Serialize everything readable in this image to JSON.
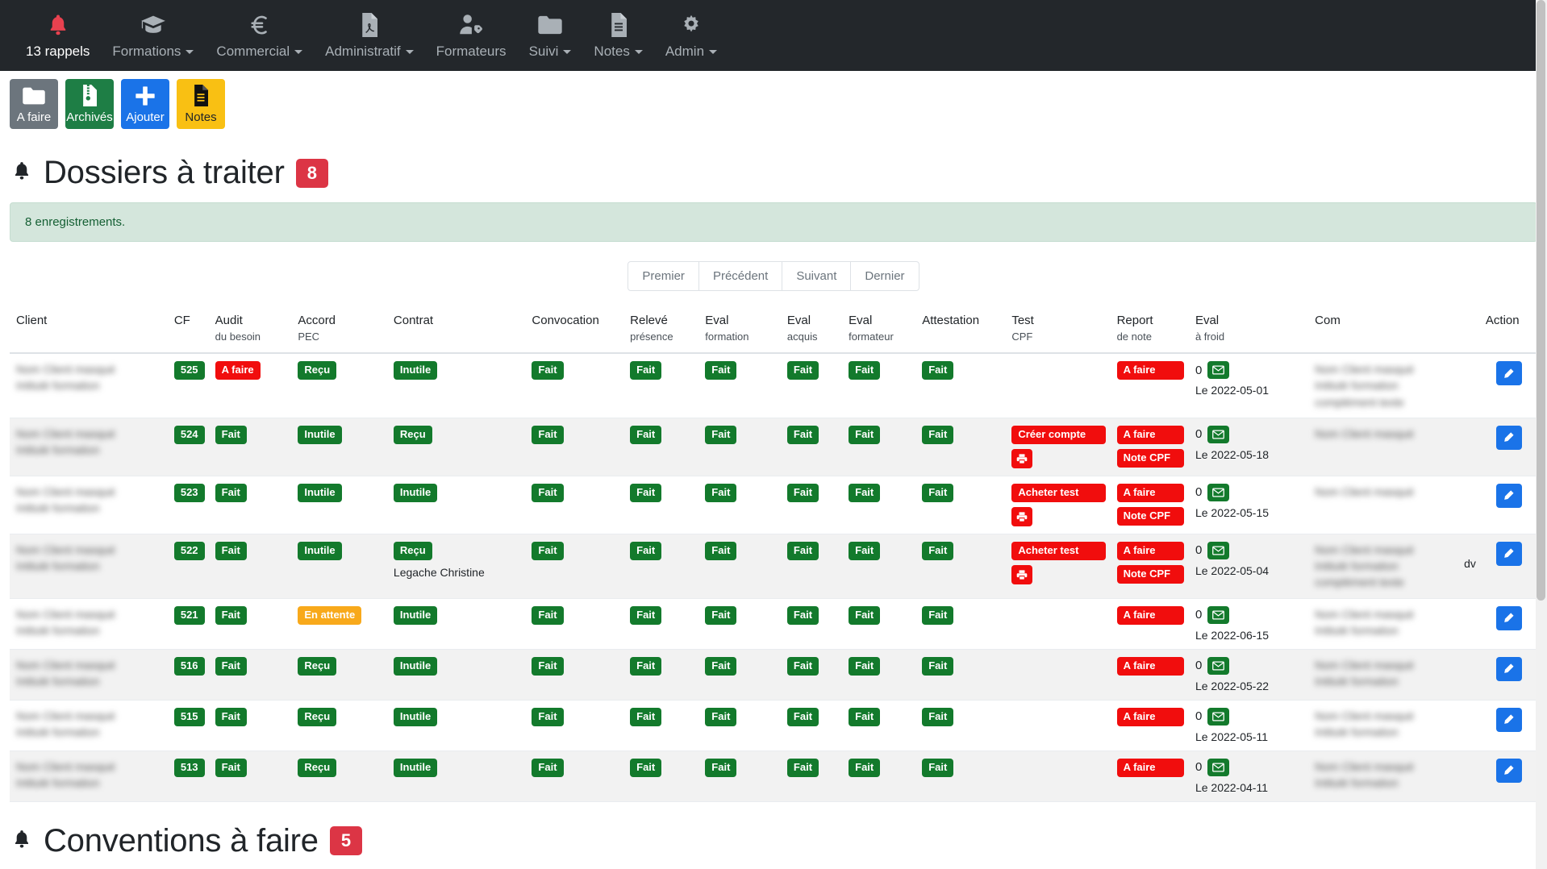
{
  "navbar": {
    "items": [
      {
        "label": "13 rappels",
        "icon": "bell-icon",
        "active": true,
        "caret": false
      },
      {
        "label": "Formations",
        "icon": "graduation-icon",
        "active": false,
        "caret": true
      },
      {
        "label": "Commercial",
        "icon": "euro-icon",
        "active": false,
        "caret": true
      },
      {
        "label": "Administratif",
        "icon": "pdf-file-icon",
        "active": false,
        "caret": true
      },
      {
        "label": "Formateurs",
        "icon": "user-tag-icon",
        "active": false,
        "caret": false
      },
      {
        "label": "Suivi",
        "icon": "folder-icon",
        "active": false,
        "caret": true
      },
      {
        "label": "Notes",
        "icon": "note-file-icon",
        "active": false,
        "caret": true
      },
      {
        "label": "Admin",
        "icon": "gear-icon",
        "active": false,
        "caret": true
      }
    ]
  },
  "toolbar": {
    "buttons": [
      {
        "label": "A faire",
        "icon": "folder-icon",
        "style": "grey"
      },
      {
        "label": "Archivés",
        "icon": "archive-icon",
        "style": "green"
      },
      {
        "label": "Ajouter",
        "icon": "plus-icon",
        "style": "blue"
      },
      {
        "label": "Notes",
        "icon": "note-icon",
        "style": "yellow"
      }
    ]
  },
  "page": {
    "title": "Dossiers à traiter",
    "title_badge": "8",
    "alert": "8 enregistrements."
  },
  "pagination": {
    "first": "Premier",
    "previous": "Précédent",
    "next": "Suivant",
    "last": "Dernier"
  },
  "table": {
    "headers": [
      {
        "main": "Client",
        "sub": ""
      },
      {
        "main": "CF",
        "sub": ""
      },
      {
        "main": "Audit",
        "sub": "du besoin"
      },
      {
        "main": "Accord",
        "sub": "PEC"
      },
      {
        "main": "Contrat",
        "sub": ""
      },
      {
        "main": "Convocation",
        "sub": ""
      },
      {
        "main": "Relevé",
        "sub": "présence"
      },
      {
        "main": "Eval",
        "sub": "formation"
      },
      {
        "main": "Eval",
        "sub": "acquis"
      },
      {
        "main": "Eval",
        "sub": "formateur"
      },
      {
        "main": "Attestation",
        "sub": ""
      },
      {
        "main": "Test",
        "sub": "CPF"
      },
      {
        "main": "Report",
        "sub": "de note"
      },
      {
        "main": "Eval",
        "sub": "à froid"
      },
      {
        "main": "Com",
        "sub": ""
      },
      {
        "main": "Action",
        "sub": ""
      }
    ],
    "rows": [
      {
        "client_redacted_lines": 2,
        "cf": "525",
        "audit": {
          "text": "A faire",
          "color": "red"
        },
        "accord": {
          "text": "Reçu",
          "color": "green"
        },
        "contrat": {
          "text": "Inutile",
          "color": "green"
        },
        "contrat_note": "",
        "convocation": {
          "text": "Fait",
          "color": "green"
        },
        "releve": {
          "text": "Fait",
          "color": "green"
        },
        "eval_formation": {
          "text": "Fait",
          "color": "green"
        },
        "eval_acquis": {
          "text": "Fait",
          "color": "green"
        },
        "eval_formateur": {
          "text": "Fait",
          "color": "green"
        },
        "attestation": {
          "text": "Fait",
          "color": "green"
        },
        "test_cpf": [],
        "test_cpf_print": false,
        "report": [
          {
            "text": "A faire",
            "color": "red"
          }
        ],
        "froid_count": "0",
        "froid_date": "Le 2022-05-01",
        "com_redacted_lines": 3,
        "com_visible": ""
      },
      {
        "client_redacted_lines": 2,
        "cf": "524",
        "audit": {
          "text": "Fait",
          "color": "green"
        },
        "accord": {
          "text": "Inutile",
          "color": "green"
        },
        "contrat": {
          "text": "Reçu",
          "color": "green"
        },
        "contrat_note": "",
        "convocation": {
          "text": "Fait",
          "color": "green"
        },
        "releve": {
          "text": "Fait",
          "color": "green"
        },
        "eval_formation": {
          "text": "Fait",
          "color": "green"
        },
        "eval_acquis": {
          "text": "Fait",
          "color": "green"
        },
        "eval_formateur": {
          "text": "Fait",
          "color": "green"
        },
        "attestation": {
          "text": "Fait",
          "color": "green"
        },
        "test_cpf": [
          {
            "text": "Créer compte",
            "color": "red"
          }
        ],
        "test_cpf_print": true,
        "report": [
          {
            "text": "A faire",
            "color": "red"
          },
          {
            "text": "Note CPF",
            "color": "red"
          }
        ],
        "froid_count": "0",
        "froid_date": "Le 2022-05-18",
        "com_redacted_lines": 1,
        "com_visible": ""
      },
      {
        "client_redacted_lines": 2,
        "cf": "523",
        "audit": {
          "text": "Fait",
          "color": "green"
        },
        "accord": {
          "text": "Inutile",
          "color": "green"
        },
        "contrat": {
          "text": "Inutile",
          "color": "green"
        },
        "contrat_note": "",
        "convocation": {
          "text": "Fait",
          "color": "green"
        },
        "releve": {
          "text": "Fait",
          "color": "green"
        },
        "eval_formation": {
          "text": "Fait",
          "color": "green"
        },
        "eval_acquis": {
          "text": "Fait",
          "color": "green"
        },
        "eval_formateur": {
          "text": "Fait",
          "color": "green"
        },
        "attestation": {
          "text": "Fait",
          "color": "green"
        },
        "test_cpf": [
          {
            "text": "Acheter test",
            "color": "red"
          }
        ],
        "test_cpf_print": true,
        "report": [
          {
            "text": "A faire",
            "color": "red"
          },
          {
            "text": "Note CPF",
            "color": "red"
          }
        ],
        "froid_count": "0",
        "froid_date": "Le 2022-05-15",
        "com_redacted_lines": 1,
        "com_visible": ""
      },
      {
        "client_redacted_lines": 2,
        "cf": "522",
        "audit": {
          "text": "Fait",
          "color": "green"
        },
        "accord": {
          "text": "Inutile",
          "color": "green"
        },
        "contrat": {
          "text": "Reçu",
          "color": "green"
        },
        "contrat_note": "Legache Christine",
        "convocation": {
          "text": "Fait",
          "color": "green"
        },
        "releve": {
          "text": "Fait",
          "color": "green"
        },
        "eval_formation": {
          "text": "Fait",
          "color": "green"
        },
        "eval_acquis": {
          "text": "Fait",
          "color": "green"
        },
        "eval_formateur": {
          "text": "Fait",
          "color": "green"
        },
        "attestation": {
          "text": "Fait",
          "color": "green"
        },
        "test_cpf": [
          {
            "text": "Acheter test",
            "color": "red"
          }
        ],
        "test_cpf_print": true,
        "report": [
          {
            "text": "A faire",
            "color": "red"
          },
          {
            "text": "Note CPF",
            "color": "red"
          }
        ],
        "froid_count": "0",
        "froid_date": "Le 2022-05-04",
        "com_redacted_lines": 3,
        "com_visible": "dv"
      },
      {
        "client_redacted_lines": 2,
        "cf": "521",
        "audit": {
          "text": "Fait",
          "color": "green"
        },
        "accord": {
          "text": "En attente",
          "color": "orange"
        },
        "contrat": {
          "text": "Inutile",
          "color": "green"
        },
        "contrat_note": "",
        "convocation": {
          "text": "Fait",
          "color": "green"
        },
        "releve": {
          "text": "Fait",
          "color": "green"
        },
        "eval_formation": {
          "text": "Fait",
          "color": "green"
        },
        "eval_acquis": {
          "text": "Fait",
          "color": "green"
        },
        "eval_formateur": {
          "text": "Fait",
          "color": "green"
        },
        "attestation": {
          "text": "Fait",
          "color": "green"
        },
        "test_cpf": [],
        "test_cpf_print": false,
        "report": [
          {
            "text": "A faire",
            "color": "red"
          }
        ],
        "froid_count": "0",
        "froid_date": "Le 2022-06-15",
        "com_redacted_lines": 2,
        "com_visible": ""
      },
      {
        "client_redacted_lines": 2,
        "cf": "516",
        "audit": {
          "text": "Fait",
          "color": "green"
        },
        "accord": {
          "text": "Reçu",
          "color": "green"
        },
        "contrat": {
          "text": "Inutile",
          "color": "green"
        },
        "contrat_note": "",
        "convocation": {
          "text": "Fait",
          "color": "green"
        },
        "releve": {
          "text": "Fait",
          "color": "green"
        },
        "eval_formation": {
          "text": "Fait",
          "color": "green"
        },
        "eval_acquis": {
          "text": "Fait",
          "color": "green"
        },
        "eval_formateur": {
          "text": "Fait",
          "color": "green"
        },
        "attestation": {
          "text": "Fait",
          "color": "green"
        },
        "test_cpf": [],
        "test_cpf_print": false,
        "report": [
          {
            "text": "A faire",
            "color": "red"
          }
        ],
        "froid_count": "0",
        "froid_date": "Le 2022-05-22",
        "com_redacted_lines": 2,
        "com_visible": ""
      },
      {
        "client_redacted_lines": 2,
        "cf": "515",
        "audit": {
          "text": "Fait",
          "color": "green"
        },
        "accord": {
          "text": "Reçu",
          "color": "green"
        },
        "contrat": {
          "text": "Inutile",
          "color": "green"
        },
        "contrat_note": "",
        "convocation": {
          "text": "Fait",
          "color": "green"
        },
        "releve": {
          "text": "Fait",
          "color": "green"
        },
        "eval_formation": {
          "text": "Fait",
          "color": "green"
        },
        "eval_acquis": {
          "text": "Fait",
          "color": "green"
        },
        "eval_formateur": {
          "text": "Fait",
          "color": "green"
        },
        "attestation": {
          "text": "Fait",
          "color": "green"
        },
        "test_cpf": [],
        "test_cpf_print": false,
        "report": [
          {
            "text": "A faire",
            "color": "red"
          }
        ],
        "froid_count": "0",
        "froid_date": "Le 2022-05-11",
        "com_redacted_lines": 2,
        "com_visible": ""
      },
      {
        "client_redacted_lines": 2,
        "cf": "513",
        "audit": {
          "text": "Fait",
          "color": "green"
        },
        "accord": {
          "text": "Reçu",
          "color": "green"
        },
        "contrat": {
          "text": "Inutile",
          "color": "green"
        },
        "contrat_note": "",
        "convocation": {
          "text": "Fait",
          "color": "green"
        },
        "releve": {
          "text": "Fait",
          "color": "green"
        },
        "eval_formation": {
          "text": "Fait",
          "color": "green"
        },
        "eval_acquis": {
          "text": "Fait",
          "color": "green"
        },
        "eval_formateur": {
          "text": "Fait",
          "color": "green"
        },
        "attestation": {
          "text": "Fait",
          "color": "green"
        },
        "test_cpf": [],
        "test_cpf_print": false,
        "report": [
          {
            "text": "A faire",
            "color": "red"
          }
        ],
        "froid_count": "0",
        "froid_date": "Le 2022-04-11",
        "com_redacted_lines": 2,
        "com_visible": ""
      }
    ]
  },
  "section2": {
    "title": "Conventions à faire",
    "badge": "5"
  },
  "colors": {
    "navbar_bg": "#23272b",
    "badge_green": "#137a2c",
    "badge_red": "#f10d0d",
    "badge_orange": "#f8a91b",
    "count_badge_red": "#dc3545",
    "edit_blue": "#1a73e8",
    "alert_bg": "#d4e6dc"
  }
}
